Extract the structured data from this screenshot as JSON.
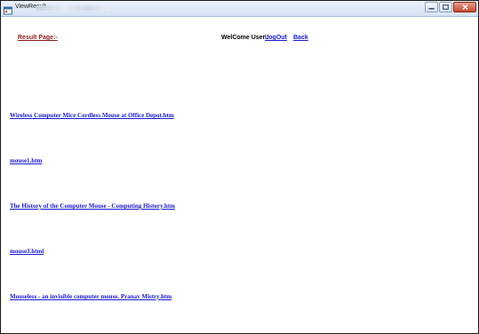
{
  "window": {
    "title": "ViewResult",
    "controls": {
      "minimize_icon": "minimize-icon",
      "maximize_icon": "maximize-icon",
      "close_icon": "close-icon"
    }
  },
  "header": {
    "result_title": "Result Page:-",
    "welcome_text": "WelCome User !",
    "logout_label": "LogOut",
    "back_label": "Back"
  },
  "results": [
    {
      "label": "Wireless Computer Mice  Cordless Mouse at Office Depot.htm"
    },
    {
      "label": "mouse1.htm"
    },
    {
      "label": "The History of the Computer Mouse - Computing History.htm"
    },
    {
      "label": "mouse3.html"
    },
    {
      "label": "Mouseless - an invisible computer mouse. Pranav Mistry.htm"
    }
  ],
  "colors": {
    "link": "#1a1acc",
    "result_title": "#8b1a1a",
    "close_button": "#c44a32"
  }
}
